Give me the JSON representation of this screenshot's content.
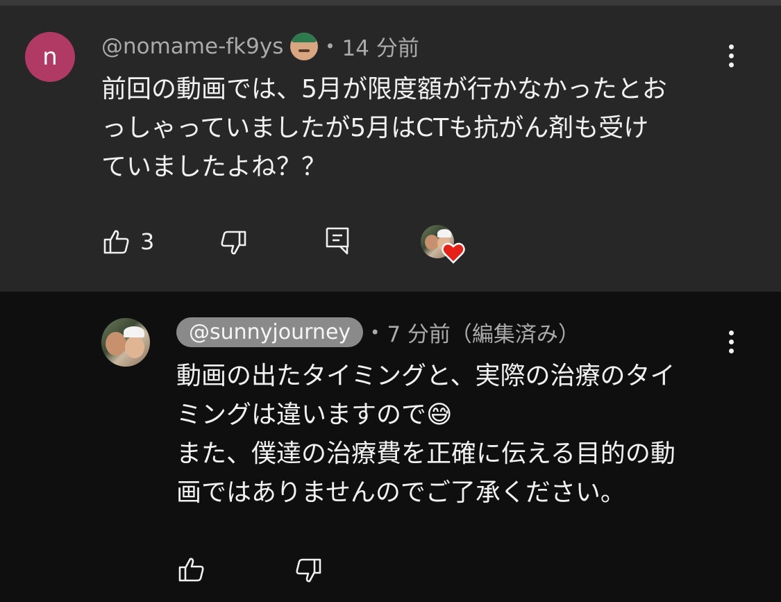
{
  "top_comment": {
    "avatar_letter": "n",
    "handle": "@nomame-fk9ys",
    "badge_icon": "member-badge-emoji-icon",
    "time": "14 分前",
    "lines": [
      "前回の動画では、5月が限度額が行かなかったとお",
      "っしゃっていましたが5月はCTも抗がん剤も受け",
      "ていましたよね？？"
    ],
    "like_count": "3",
    "colors": {
      "background": "#272727",
      "avatar": "#b03a63",
      "heart": "#e62117"
    }
  },
  "reply": {
    "handle": "@sunnyjourney",
    "time": "7 分前（編集済み）",
    "lines": [
      "動画の出たタイミングと、実際の治療のタイ",
      "ミングは違いますので😅",
      "また、僕達の治療費を正確に伝える目的の動",
      "画ではありませんのでご了承ください。"
    ],
    "colors": {
      "background": "#0f0f0f",
      "handle_pill": "#8a8a8a"
    }
  }
}
